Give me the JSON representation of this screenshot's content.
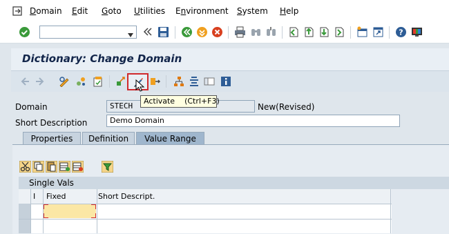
{
  "menu": {
    "items": [
      {
        "label": "Domain",
        "accel": "D"
      },
      {
        "label": "Edit",
        "accel": "E"
      },
      {
        "label": "Goto",
        "accel": "G"
      },
      {
        "label": "Utilities",
        "accel": "U"
      },
      {
        "label": "Environment",
        "accel": "n"
      },
      {
        "label": "System",
        "accel": "S"
      },
      {
        "label": "Help",
        "accel": "H"
      }
    ]
  },
  "toolbar": {
    "command_field": {
      "value": ""
    },
    "icons": [
      "enter-icon",
      "back-arrows-icon",
      "save-icon",
      "back-icon",
      "exit-icon",
      "cancel-icon",
      "print-icon",
      "find-icon",
      "find-next-icon",
      "first-page-icon",
      "previous-page-icon",
      "next-page-icon",
      "last-page-icon",
      "create-session-icon",
      "shortcut-icon",
      "help-icon",
      "customize-layout-icon"
    ]
  },
  "title": "Dictionary: Change Domain",
  "application_toolbar": {
    "icons": [
      "back-arrow-icon",
      "forward-arrow-icon",
      "display-change-icon",
      "other-object-icon",
      "check-icon",
      "activate-icon",
      "where-used-icon",
      "hierarchy-icon",
      "indent-icon",
      "layout-icon",
      "info-icon"
    ],
    "tooltip": "Activate    (Ctrl+F3)"
  },
  "form": {
    "domain_label": "Domain",
    "domain_value": "STECH",
    "domain_status": "New(Revised)",
    "short_desc_label": "Short Description",
    "short_desc_value": "Demo Domain"
  },
  "tabs": [
    {
      "label": "Properties",
      "active": false
    },
    {
      "label": "Definition",
      "active": false
    },
    {
      "label": "Value Range",
      "active": true
    }
  ],
  "table_toolbar": {
    "icons": [
      "cut-icon",
      "copy-icon",
      "paste-icon",
      "insert-row-icon",
      "delete-row-icon",
      "filter-icon"
    ]
  },
  "single_vals": {
    "title": "Single Vals",
    "columns": [
      "I",
      "Fixed",
      "Short Descript."
    ]
  },
  "colors": {
    "title_text": "#12254a",
    "menu_bg": "#ffffff",
    "active_tab": "#9fb6cd",
    "tooltip_bg": "#ffffe1",
    "highlight_red": "#d0282c"
  }
}
